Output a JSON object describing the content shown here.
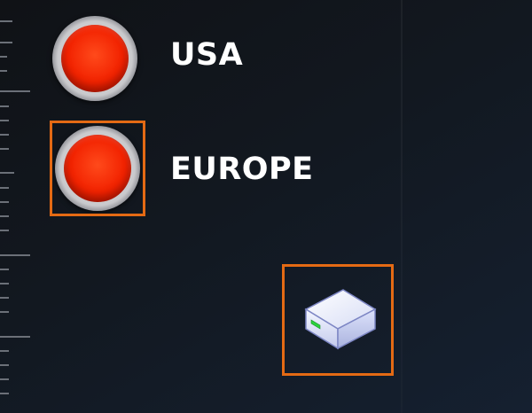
{
  "regions": [
    {
      "label": "USA",
      "status_color": "#f22200",
      "indicator_icon": "red-status-led-icon",
      "selected": false
    },
    {
      "label": "EUROPE",
      "status_color": "#f22200",
      "indicator_icon": "red-status-led-icon",
      "selected": true
    }
  ],
  "drive": {
    "icon": "storage-drive-icon",
    "selected": true
  },
  "colors": {
    "selection_outline": "#e46a14",
    "background": "#121820",
    "label_text": "#ffffff"
  }
}
